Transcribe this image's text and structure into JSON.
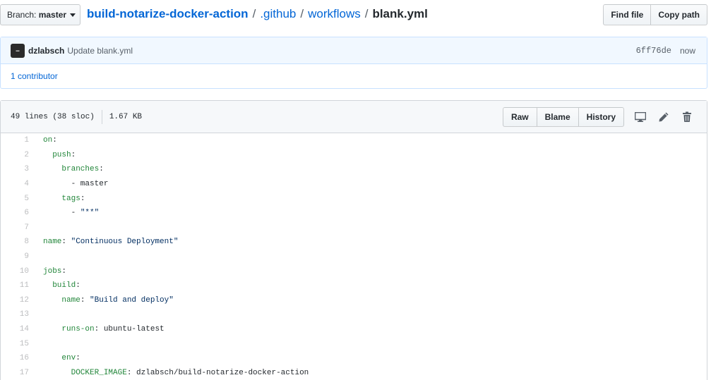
{
  "branch": {
    "label": "Branch:",
    "value": "master"
  },
  "breadcrumb": {
    "repo": "build-notarize-docker-action",
    "dir1": ".github",
    "dir2": "workflows",
    "file": "blank.yml",
    "sep": "/"
  },
  "actions": {
    "find_file": "Find file",
    "copy_path": "Copy path"
  },
  "commit": {
    "author": "dzlabsch",
    "message": "Update blank.yml",
    "sha": "6ff76de",
    "time": "now",
    "contributors": "1 contributor"
  },
  "file_info": {
    "lines": "49 lines (38 sloc)",
    "size": "1.67 KB"
  },
  "file_actions": {
    "raw": "Raw",
    "blame": "Blame",
    "history": "History"
  },
  "icons": [
    "desktop-icon",
    "pencil-icon",
    "trash-icon"
  ],
  "colors": {
    "link": "#0366d6",
    "key": "#22863a",
    "string": "#032f62"
  },
  "code_lines": [
    {
      "n": "1",
      "parts": [
        {
          "t": "on",
          "c": "k"
        },
        {
          "t": ":",
          "c": ""
        }
      ]
    },
    {
      "n": "2",
      "parts": [
        {
          "t": "  ",
          "c": ""
        },
        {
          "t": "push",
          "c": "k"
        },
        {
          "t": ":",
          "c": ""
        }
      ]
    },
    {
      "n": "3",
      "parts": [
        {
          "t": "    ",
          "c": ""
        },
        {
          "t": "branches",
          "c": "k"
        },
        {
          "t": ":",
          "c": ""
        }
      ]
    },
    {
      "n": "4",
      "parts": [
        {
          "t": "      - master",
          "c": ""
        }
      ]
    },
    {
      "n": "5",
      "parts": [
        {
          "t": "    ",
          "c": ""
        },
        {
          "t": "tags",
          "c": "k"
        },
        {
          "t": ":",
          "c": ""
        }
      ]
    },
    {
      "n": "6",
      "parts": [
        {
          "t": "      - ",
          "c": ""
        },
        {
          "t": "\"**\"",
          "c": "s"
        }
      ]
    },
    {
      "n": "7",
      "parts": []
    },
    {
      "n": "8",
      "parts": [
        {
          "t": "name",
          "c": "k"
        },
        {
          "t": ": ",
          "c": ""
        },
        {
          "t": "\"Continuous Deployment\"",
          "c": "s"
        }
      ]
    },
    {
      "n": "9",
      "parts": []
    },
    {
      "n": "10",
      "parts": [
        {
          "t": "jobs",
          "c": "k"
        },
        {
          "t": ":",
          "c": ""
        }
      ]
    },
    {
      "n": "11",
      "parts": [
        {
          "t": "  ",
          "c": ""
        },
        {
          "t": "build",
          "c": "k"
        },
        {
          "t": ":",
          "c": ""
        }
      ]
    },
    {
      "n": "12",
      "parts": [
        {
          "t": "    ",
          "c": ""
        },
        {
          "t": "name",
          "c": "k"
        },
        {
          "t": ": ",
          "c": ""
        },
        {
          "t": "\"Build and deploy\"",
          "c": "s"
        }
      ]
    },
    {
      "n": "13",
      "parts": []
    },
    {
      "n": "14",
      "parts": [
        {
          "t": "    ",
          "c": ""
        },
        {
          "t": "runs-on",
          "c": "k"
        },
        {
          "t": ": ubuntu-latest",
          "c": ""
        }
      ]
    },
    {
      "n": "15",
      "parts": []
    },
    {
      "n": "16",
      "parts": [
        {
          "t": "    ",
          "c": ""
        },
        {
          "t": "env",
          "c": "k"
        },
        {
          "t": ":",
          "c": ""
        }
      ]
    },
    {
      "n": "17",
      "parts": [
        {
          "t": "      ",
          "c": ""
        },
        {
          "t": "DOCKER_IMAGE",
          "c": "k"
        },
        {
          "t": ": dzlabsch/build-notarize-docker-action",
          "c": ""
        }
      ]
    }
  ]
}
